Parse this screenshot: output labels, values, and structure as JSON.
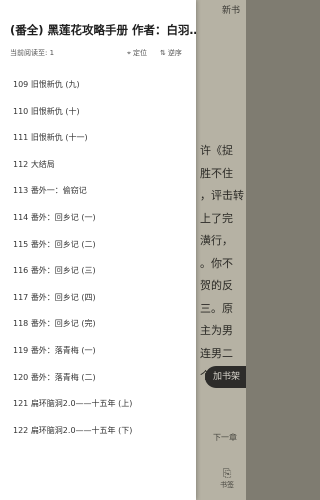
{
  "reader": {
    "top_fragment": "新书",
    "text_lines": [
      "许《捉",
      "胜不住",
      "，评击转",
      "上了完",
      "潢行，",
      "。你不",
      "贺的反",
      "三。原",
      "主为男",
      "连男二",
      "个大大"
    ],
    "add_shelf_label": "加书架",
    "next_chapter_label": "下一章",
    "bottom_tool_label": "书签",
    "bottom_tool_icon": "bookmark-icon"
  },
  "drawer": {
    "title": "(番全) 黑莲花攻略手册 作者：白羽…",
    "current_label": "当前阅读至: ",
    "current_value": "1",
    "locate_label": "定位",
    "locate_icon": "target-icon",
    "order_label": "逆序",
    "order_icon": "sort-icon",
    "chapters": [
      "109 旧恨新仇 (九)",
      "110 旧恨新仇 (十)",
      "111 旧恨新仇 (十一)",
      "112 大结局",
      "113 番外一：偷窃记",
      "114 番外：回乡记 (一)",
      "115 番外：回乡记 (二)",
      "116 番外：回乡记 (三)",
      "117 番外：回乡记 (四)",
      "118 番外：回乡记 (完)",
      "119 番外：落青梅 (一)",
      "120 番外：落青梅 (二)",
      "121 扁环脑洞2.0——十五年 (上)",
      "122 扁环脑洞2.0——十五年 (下)"
    ]
  }
}
